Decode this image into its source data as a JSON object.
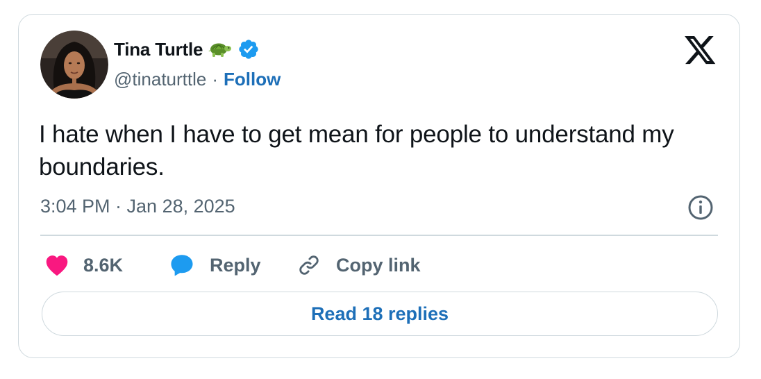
{
  "author": {
    "display_name": "Tina Turtle",
    "emoji": "🐢",
    "handle": "@tinaturttle",
    "separator": "·",
    "follow_label": "Follow",
    "verified_icon": "verified-badge-icon",
    "avatar": "avatar"
  },
  "platform_icon": "x-logo-icon",
  "tweet": {
    "text": "I hate when I have to get mean for people to understand my boundaries.",
    "timestamp": "3:04 PM · Jan 28, 2025"
  },
  "actions": {
    "like_count": "8.6K",
    "reply_label": "Reply",
    "copy_label": "Copy link"
  },
  "read_replies_label": "Read 18 replies",
  "colors": {
    "text": "#0f1419",
    "secondary": "#536471",
    "link": "#1d6fb8",
    "verified": "#1d9bf0",
    "like": "#f91880",
    "border": "#cfd9de"
  }
}
